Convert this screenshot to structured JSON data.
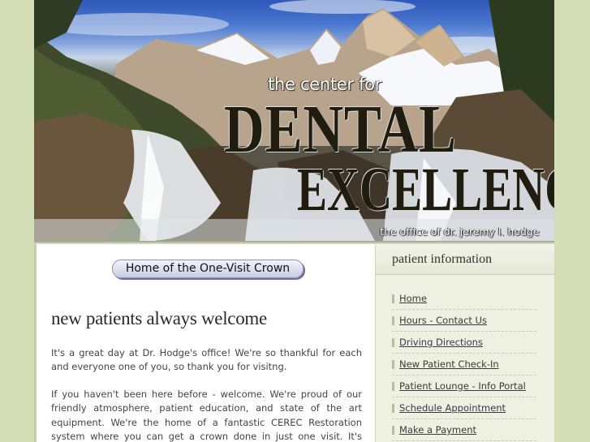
{
  "banner": {
    "title_line1": "the center for",
    "title_dental": "DENTAL",
    "title_excellence": "EXCELLENCE",
    "office_line": "the office of dr. jeremy l. hodge"
  },
  "main": {
    "crown_button": "Home of the One-Visit Crown",
    "heading": "new patients always welcome",
    "paragraph1": "It's a great day at Dr. Hodge's office! We're so thankful for each and everyone one of you, so thank you for visitng.",
    "paragraph2": "If you haven't been here before - welcome. We're proud of our friendly atmosphere, patient education, and state of the art equipment. We're the home of a fantastic CEREC Restoration system where you can get a crown done in just one visit. It's amazing, and saves you having to"
  },
  "sidebar": {
    "title": "patient information",
    "items": [
      {
        "label": "Home"
      },
      {
        "label": "Hours - Contact Us"
      },
      {
        "label": "Driving Directions"
      },
      {
        "label": "New Patient Check-In"
      },
      {
        "label": "Patient Lounge - Info Portal"
      },
      {
        "label": "Schedule Appointment"
      },
      {
        "label": "Make a Payment"
      }
    ]
  },
  "colors": {
    "page_background": "#d3ddb6",
    "sidebar_background": "#eef0e2",
    "title_text": "#201c10"
  }
}
